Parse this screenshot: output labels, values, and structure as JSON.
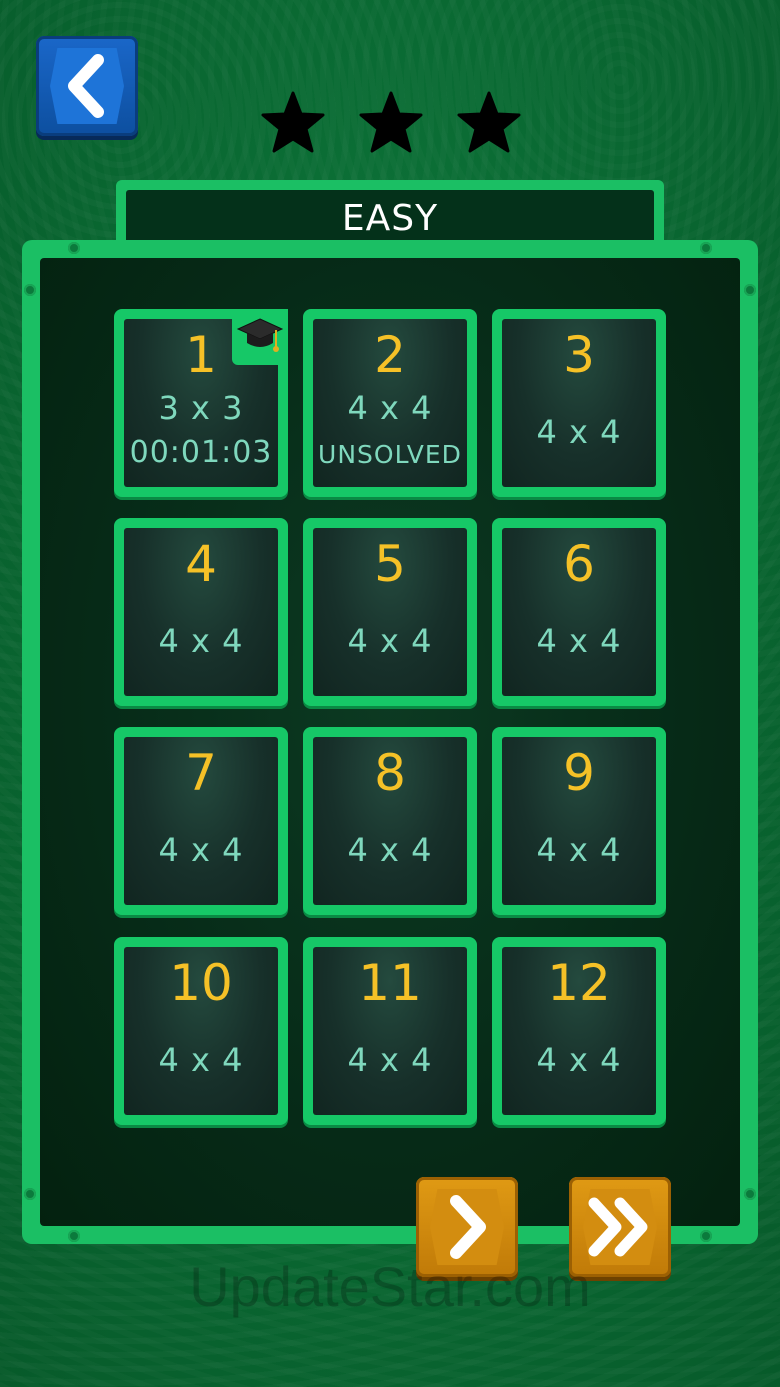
{
  "header": {
    "back_icon": "chevron-left-icon",
    "stars": [
      "star-icon",
      "star-icon",
      "star-icon"
    ],
    "difficulty": "EASY"
  },
  "levels": [
    {
      "number": "1",
      "size": "3 x 3",
      "status": "00:01:03",
      "badge": "graduation-cap-icon"
    },
    {
      "number": "2",
      "size": "4 x 4",
      "status": "UNSOLVED"
    },
    {
      "number": "3",
      "size": "4 x 4"
    },
    {
      "number": "4",
      "size": "4 x 4"
    },
    {
      "number": "5",
      "size": "4 x 4"
    },
    {
      "number": "6",
      "size": "4 x 4"
    },
    {
      "number": "7",
      "size": "4 x 4"
    },
    {
      "number": "8",
      "size": "4 x 4"
    },
    {
      "number": "9",
      "size": "4 x 4"
    },
    {
      "number": "10",
      "size": "4 x 4"
    },
    {
      "number": "11",
      "size": "4 x 4"
    },
    {
      "number": "12",
      "size": "4 x 4"
    }
  ],
  "footer": {
    "next_icon": "chevron-right-icon",
    "last_icon": "double-chevron-right-icon",
    "watermark": "UpdateStar.com"
  },
  "colors": {
    "background": "#0a6a33",
    "frame": "#1bbf64",
    "level_number": "#f5c127",
    "level_text": "#7fd8bd",
    "back_button": "#1a67c9",
    "nav_button": "#e09a14"
  }
}
